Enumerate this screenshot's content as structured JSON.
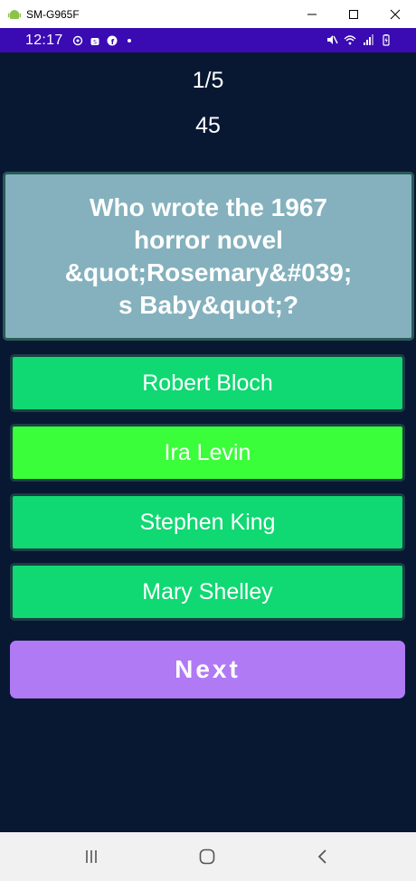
{
  "window": {
    "title": "SM-G965F",
    "icons": [
      "android-icon",
      "minimize-icon",
      "maximize-icon",
      "close-icon"
    ]
  },
  "statusbar": {
    "time": "12:17",
    "left_icons": [
      "whatsapp-icon",
      "store-icon",
      "facebook-icon",
      "dot-icon"
    ],
    "right_icons": [
      "mute-icon",
      "wifi-icon",
      "signal-icon",
      "battery-icon"
    ],
    "color": "#3a0ab2"
  },
  "quiz": {
    "progress": "1/5",
    "timer": "45",
    "question": "Who wrote the 1967 horror novel &quot;Rosemary&#039;s Baby&quot;?",
    "answers": [
      "Robert Bloch",
      "Ira Levin",
      "Stephen King",
      "Mary Shelley"
    ],
    "selected_index": 1,
    "next_label": "Next"
  },
  "colors": {
    "background": "#081833",
    "question_card": "#84b1bd",
    "answer": "#10d872",
    "answer_selected": "#3afe3a",
    "next_button": "#b07af5"
  },
  "navbar": {
    "icons": [
      "recent-apps-icon",
      "home-icon",
      "back-icon"
    ]
  }
}
